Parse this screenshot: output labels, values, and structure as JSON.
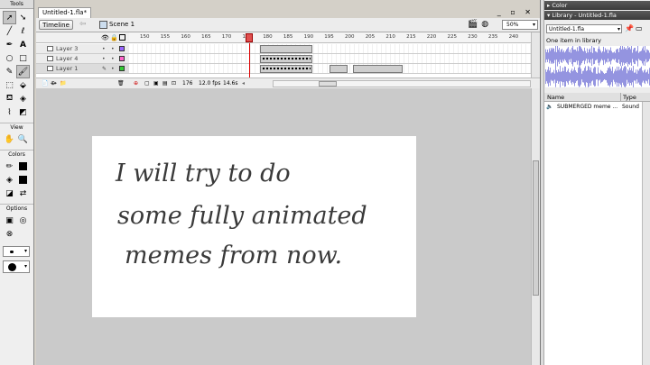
{
  "tools_panel": {
    "title": "Tools",
    "sections": {
      "view": "View",
      "colors": "Colors",
      "options": "Options"
    }
  },
  "document": {
    "tab_title": "Untitled-1.fla*",
    "window_controls": "_ ▫ ✕"
  },
  "edit_bar": {
    "timeline_button": "Timeline",
    "scene_label": "Scene 1",
    "zoom": "50%"
  },
  "timeline": {
    "frame_ticks": [
      "150",
      "155",
      "160",
      "165",
      "170",
      "175",
      "180",
      "185",
      "190",
      "195",
      "200",
      "205",
      "210",
      "215",
      "220",
      "225",
      "230",
      "235",
      "240"
    ],
    "layers": [
      {
        "name": "Layer 3",
        "color": "#9966ff"
      },
      {
        "name": "Layer 4",
        "color": "#ff66cc"
      },
      {
        "name": "Layer 1",
        "color": "#33cc33"
      }
    ],
    "current_frame": "176",
    "fps": "12.0 fps",
    "elapsed": "14.6s"
  },
  "stage": {
    "text_lines": [
      "I  will  try  to do",
      "some  fully  animated",
      "memes   from  now."
    ]
  },
  "panels": {
    "color_title": "Color",
    "library_title": "Library - Untitled-1.fla",
    "library_select": "Untitled-1.fla",
    "library_count": "One item in library",
    "columns": {
      "name": "Name",
      "type": "Type"
    },
    "items": [
      {
        "name": "SUBMERGED meme ...",
        "type": "Sound"
      }
    ]
  }
}
